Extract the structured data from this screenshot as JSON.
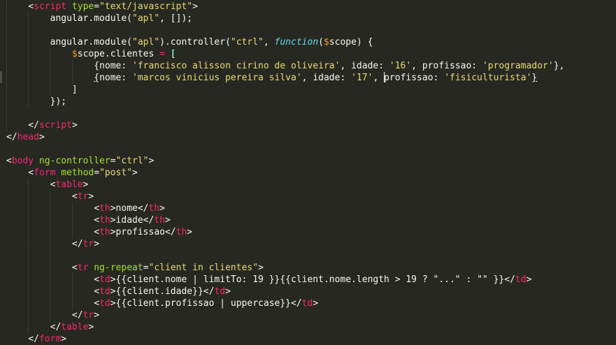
{
  "editor": {
    "theme_colors": {
      "background": "#272822",
      "text": "#f8f8f2",
      "tag": "#f92672",
      "attribute": "#a6e22e",
      "string": "#e6db74",
      "keyword": "#66d9ef",
      "variable": "#fd971f"
    },
    "lines": [
      [
        {
          "c": "p",
          "t": "    <"
        },
        {
          "c": "t",
          "t": "script"
        },
        {
          "c": "p",
          "t": " "
        },
        {
          "c": "a",
          "t": "type"
        },
        {
          "c": "p",
          "t": "="
        },
        {
          "c": "s",
          "t": "\"text/javascript\""
        },
        {
          "c": "p",
          "t": ">"
        }
      ],
      [
        {
          "c": "p",
          "t": "        angular.module("
        },
        {
          "c": "s",
          "t": "\"apl\""
        },
        {
          "c": "p",
          "t": ", []);"
        }
      ],
      [],
      [
        {
          "c": "p",
          "t": "        angular.module("
        },
        {
          "c": "s",
          "t": "\"apl\""
        },
        {
          "c": "p",
          "t": ").controller("
        },
        {
          "c": "s",
          "t": "\"ctrl\""
        },
        {
          "c": "p",
          "t": ", "
        },
        {
          "c": "k",
          "t": "function"
        },
        {
          "c": "p",
          "t": "("
        },
        {
          "c": "v",
          "t": "$"
        },
        {
          "c": "p",
          "t": "scope) {"
        }
      ],
      [
        {
          "c": "p",
          "t": "            "
        },
        {
          "c": "v",
          "t": "$"
        },
        {
          "c": "p",
          "t": "scope.clientes "
        },
        {
          "c": "o",
          "t": "="
        },
        {
          "c": "p",
          "t": " ["
        }
      ],
      [
        {
          "c": "p",
          "t": "                {nome: "
        },
        {
          "c": "s",
          "t": "'francisco alisson cirino de oliveira'"
        },
        {
          "c": "p",
          "t": ", idade: "
        },
        {
          "c": "s",
          "t": "'16'"
        },
        {
          "c": "p",
          "t": ", profissao: "
        },
        {
          "c": "s",
          "t": "'programador'"
        },
        {
          "c": "p",
          "t": "},"
        }
      ],
      [
        {
          "c": "p",
          "t": "                "
        },
        {
          "c": "ul",
          "t": "{"
        },
        {
          "c": "p",
          "t": "nome: "
        },
        {
          "c": "s",
          "t": "'marcos vinicius pereira silva'"
        },
        {
          "c": "p",
          "t": ", idade: "
        },
        {
          "c": "s",
          "t": "'17'"
        },
        {
          "c": "p",
          "t": ", "
        },
        {
          "c": "caret",
          "t": ""
        },
        {
          "c": "p",
          "t": "profissao: "
        },
        {
          "c": "s",
          "t": "'fisiculturista'"
        },
        {
          "c": "ul",
          "t": "}"
        }
      ],
      [
        {
          "c": "p",
          "t": "            ]"
        }
      ],
      [
        {
          "c": "p",
          "t": "        });"
        }
      ],
      [],
      [
        {
          "c": "p",
          "t": "    </"
        },
        {
          "c": "t",
          "t": "script"
        },
        {
          "c": "p",
          "t": ">"
        }
      ],
      [
        {
          "c": "p",
          "t": "</"
        },
        {
          "c": "t",
          "t": "head"
        },
        {
          "c": "p",
          "t": ">"
        }
      ],
      [],
      [
        {
          "c": "p",
          "t": "<"
        },
        {
          "c": "t",
          "t": "body"
        },
        {
          "c": "p",
          "t": " "
        },
        {
          "c": "a",
          "t": "ng-controller"
        },
        {
          "c": "p",
          "t": "="
        },
        {
          "c": "s",
          "t": "\"ctrl\""
        },
        {
          "c": "p",
          "t": ">"
        }
      ],
      [
        {
          "c": "p",
          "t": "    <"
        },
        {
          "c": "t",
          "t": "form"
        },
        {
          "c": "p",
          "t": " "
        },
        {
          "c": "a",
          "t": "method"
        },
        {
          "c": "p",
          "t": "="
        },
        {
          "c": "s",
          "t": "\"post\""
        },
        {
          "c": "p",
          "t": ">"
        }
      ],
      [
        {
          "c": "p",
          "t": "        <"
        },
        {
          "c": "t",
          "t": "table"
        },
        {
          "c": "p",
          "t": ">"
        }
      ],
      [
        {
          "c": "p",
          "t": "            <"
        },
        {
          "c": "t",
          "t": "tr"
        },
        {
          "c": "p",
          "t": ">"
        }
      ],
      [
        {
          "c": "p",
          "t": "                <"
        },
        {
          "c": "t",
          "t": "th"
        },
        {
          "c": "p",
          "t": ">nome</"
        },
        {
          "c": "t",
          "t": "th"
        },
        {
          "c": "p",
          "t": ">"
        }
      ],
      [
        {
          "c": "p",
          "t": "                <"
        },
        {
          "c": "t",
          "t": "th"
        },
        {
          "c": "p",
          "t": ">idade</"
        },
        {
          "c": "t",
          "t": "th"
        },
        {
          "c": "p",
          "t": ">"
        }
      ],
      [
        {
          "c": "p",
          "t": "                <"
        },
        {
          "c": "t",
          "t": "th"
        },
        {
          "c": "p",
          "t": ">profissao</"
        },
        {
          "c": "t",
          "t": "th"
        },
        {
          "c": "p",
          "t": ">"
        }
      ],
      [
        {
          "c": "p",
          "t": "            </"
        },
        {
          "c": "t",
          "t": "tr"
        },
        {
          "c": "p",
          "t": ">"
        }
      ],
      [],
      [
        {
          "c": "p",
          "t": "            <"
        },
        {
          "c": "t",
          "t": "tr"
        },
        {
          "c": "p",
          "t": " "
        },
        {
          "c": "a",
          "t": "ng-repeat"
        },
        {
          "c": "p",
          "t": "="
        },
        {
          "c": "s",
          "t": "\"client in clientes\""
        },
        {
          "c": "p",
          "t": ">"
        }
      ],
      [
        {
          "c": "p",
          "t": "                <"
        },
        {
          "c": "t",
          "t": "td"
        },
        {
          "c": "p",
          "t": ">{{client.nome | limitTo: 19 }}{{client.nome.length > 19 ? \"...\" : \"\" }}</"
        },
        {
          "c": "t",
          "t": "td"
        },
        {
          "c": "p",
          "t": ">"
        }
      ],
      [
        {
          "c": "p",
          "t": "                <"
        },
        {
          "c": "t",
          "t": "td"
        },
        {
          "c": "p",
          "t": ">{{client.idade}}</"
        },
        {
          "c": "t",
          "t": "td"
        },
        {
          "c": "p",
          "t": ">"
        }
      ],
      [
        {
          "c": "p",
          "t": "                <"
        },
        {
          "c": "t",
          "t": "td"
        },
        {
          "c": "p",
          "t": ">{{client.profissao | uppercase}}</"
        },
        {
          "c": "t",
          "t": "td"
        },
        {
          "c": "p",
          "t": ">"
        }
      ],
      [
        {
          "c": "p",
          "t": "            </"
        },
        {
          "c": "t",
          "t": "tr"
        },
        {
          "c": "p",
          "t": ">"
        }
      ],
      [
        {
          "c": "p",
          "t": "        </"
        },
        {
          "c": "t",
          "t": "table"
        },
        {
          "c": "p",
          "t": ">"
        }
      ],
      [
        {
          "c": "p",
          "t": "    </"
        },
        {
          "c": "t",
          "t": "form"
        },
        {
          "c": "p",
          "t": ">"
        }
      ]
    ]
  }
}
